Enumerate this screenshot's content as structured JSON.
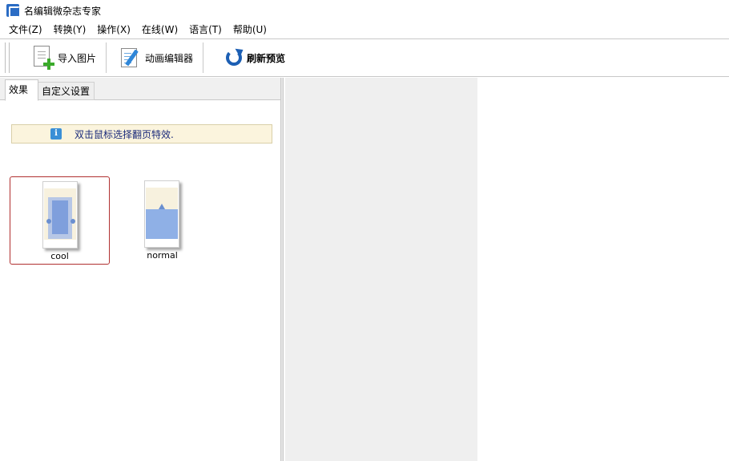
{
  "window": {
    "title": "名编辑微杂志专家"
  },
  "menu": [
    "文件(Z)",
    "转换(Y)",
    "操作(X)",
    "在线(W)",
    "语言(T)",
    "帮助(U)"
  ],
  "toolbar": {
    "import": {
      "label": "导入图片",
      "icon": "import-image-icon"
    },
    "anim": {
      "label": "动画编辑器",
      "icon": "animation-editor-icon"
    },
    "refresh": {
      "label": "刷新预览",
      "icon": "refresh-icon"
    }
  },
  "tabs": {
    "effects": "效果",
    "custom": "自定义设置"
  },
  "info": {
    "text": "双击鼠标选择翻页特效."
  },
  "effects": [
    {
      "label": "cool",
      "selected": true
    },
    {
      "label": "normal",
      "selected": false
    }
  ],
  "colors": {
    "info_bg": "#fbf4dd",
    "selection_border": "#b03030",
    "accent_blue": "#1c5fb4"
  }
}
